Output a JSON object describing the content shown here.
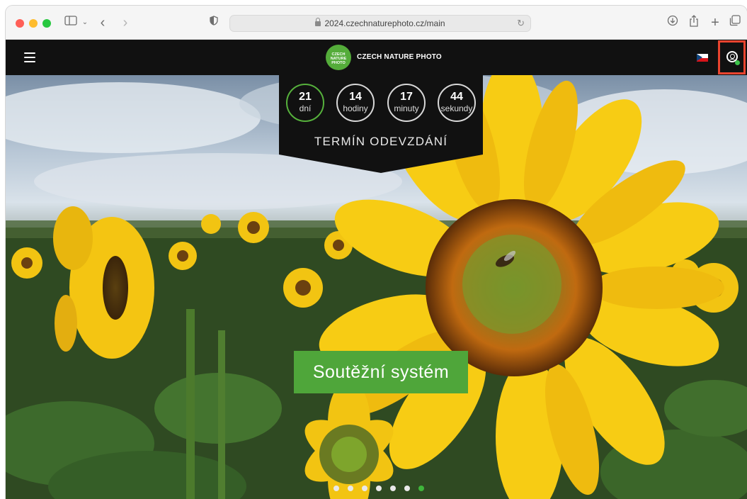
{
  "browser": {
    "url": "2024.czechnaturephoto.cz/main",
    "icons": [
      "sidebar-icon",
      "chevron-down-icon",
      "back-icon",
      "forward-icon",
      "privacy-shield-icon",
      "lock-icon",
      "reload-icon",
      "download-icon",
      "share-icon",
      "new-tab-icon",
      "tab-overview-icon"
    ]
  },
  "navbar": {
    "logo_badge_line1": "CZECH",
    "logo_badge_line2": "NATURE",
    "logo_badge_line3": "PHOTO",
    "logo_text": "CZECH NATURE PHOTO",
    "language": "cs",
    "account_icon": "user-circle-icon"
  },
  "countdown": {
    "items": [
      {
        "value": "21",
        "label": "dní"
      },
      {
        "value": "14",
        "label": "hodiny"
      },
      {
        "value": "17",
        "label": "minuty"
      },
      {
        "value": "44",
        "label": "sekundy"
      }
    ],
    "title": "TERMÍN ODEVZDÁNÍ"
  },
  "hero": {
    "cta_label": "Soutěžní systém",
    "slides_total": 7,
    "active_slide": 7
  },
  "colors": {
    "accent_green": "#4fa63a",
    "navbar_bg": "#111111",
    "highlight_red": "#e9442f"
  }
}
